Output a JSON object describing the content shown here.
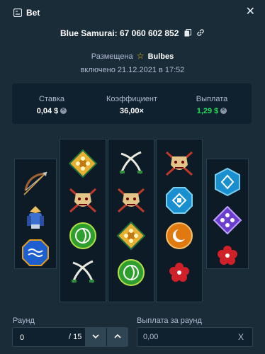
{
  "header": {
    "title": "Bet",
    "close_icon": "close-icon",
    "bet_icon": "dice-bet-icon"
  },
  "bet": {
    "title": "Blue Samurai: 67 060 602 852",
    "copy_icon": "copy-icon",
    "link_icon": "link-icon"
  },
  "placed": {
    "prefix": "Размещена",
    "user": "Bulbes",
    "date": "включено 21.12.2021 в 17:52"
  },
  "stats": [
    {
      "label": "Ставка",
      "value": "0,04 $",
      "color": "#ffffff"
    },
    {
      "label": "Коэффициент",
      "value": "36,00×",
      "color": "#ffffff"
    },
    {
      "label": "Выплата",
      "value": "1,29 $",
      "color": "#1fe05a"
    }
  ],
  "reels": [
    [
      "bow-arrow",
      "samurai-armor",
      "blue-wave-token"
    ],
    [
      "gold-flower-token",
      "samurai-mask",
      "green-swirl-token",
      "crossed-blades"
    ],
    [
      "crossed-blades",
      "samurai-mask",
      "gold-flower-token",
      "green-swirl-token"
    ],
    [
      "samurai-mask",
      "blue-diamond-token",
      "orange-moon-token",
      "red-flower-token"
    ],
    [
      "blue-hexagon-token",
      "purple-dots-token",
      "red-flower-token"
    ]
  ],
  "round": {
    "label": "Раунд",
    "value": "0",
    "total": "/ 15"
  },
  "round_payout": {
    "label": "Выплата за раунд",
    "value": "0,00",
    "clear": "X"
  }
}
